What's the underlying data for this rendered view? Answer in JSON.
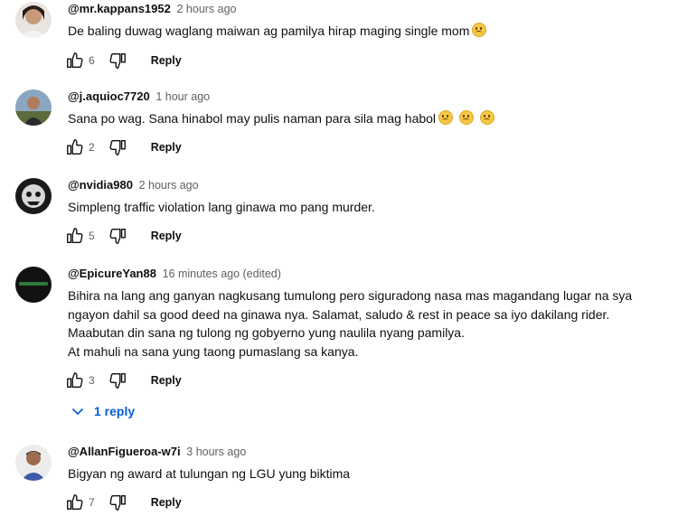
{
  "comments": [
    {
      "author": "@mr.kappans1952",
      "time": "2 hours ago",
      "lines": [
        "De baling duwag waglang maiwan ag pamilya hirap maging single mom"
      ],
      "emoji_count": 1,
      "likes": "6",
      "reply_label": "Reply"
    },
    {
      "author": "@j.aquioc7720",
      "time": "1 hour ago",
      "lines": [
        "Sana po wag. Sana hinabol may pulis naman  para sila mag habol"
      ],
      "emoji_count": 3,
      "likes": "2",
      "reply_label": "Reply"
    },
    {
      "author": "@nvidia980",
      "time": "2 hours ago",
      "lines": [
        "Simpleng traffic violation lang ginawa mo pang murder."
      ],
      "emoji_count": 0,
      "likes": "5",
      "reply_label": "Reply"
    },
    {
      "author": "@EpicureYan88",
      "time": "16 minutes ago (edited)",
      "lines": [
        "Bihira na lang ang ganyan nagkusang tumulong pero siguradong nasa mas magandang lugar na sya",
        "ngayon dahil sa good deed na ginawa nya. Salamat, saludo & rest in peace sa iyo dakilang rider.",
        "Maabutan din sana ng tulong ng gobyerno yung naulila nyang pamilya.",
        "At mahuli na sana yung taong pumaslang sa kanya."
      ],
      "emoji_count": 0,
      "likes": "3",
      "reply_label": "Reply",
      "replies_label": "1 reply"
    },
    {
      "author": "@AllanFigueroa-w7i",
      "time": "3 hours ago",
      "lines": [
        "Bigyan ng award at tulungan ng LGU yung biktima"
      ],
      "emoji_count": 0,
      "likes": "7",
      "reply_label": "Reply"
    }
  ],
  "colors": {
    "link_blue": "#065fd4",
    "meta_gray": "#606060",
    "text": "#0f0f0f"
  },
  "icons": {
    "like": "thumbs-up-icon",
    "dislike": "thumbs-down-icon",
    "expand": "chevron-down-icon",
    "emoji": "sad-face-emoji"
  }
}
